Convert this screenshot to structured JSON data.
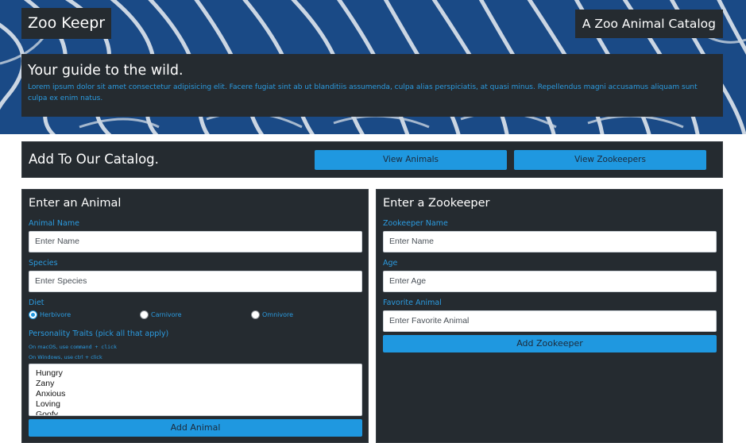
{
  "header": {
    "logo": "Zoo Keepr",
    "tagline": "A Zoo Animal Catalog"
  },
  "hero": {
    "title": "Your guide to the wild.",
    "text": "Lorem ipsum dolor sit amet consectetur adipisicing elit. Facere fugiat sint ab ut blanditiis assumenda, culpa alias perspiciatis, at quasi minus. Repellendus magni accusamus aliquam sunt culpa ex enim natus."
  },
  "catalog_bar": {
    "title": "Add To Our Catalog.",
    "view_animals": "View Animals",
    "view_zookeepers": "View Zookeepers"
  },
  "animal_form": {
    "title": "Enter an Animal",
    "name_label": "Animal Name",
    "name_placeholder": "Enter Name",
    "species_label": "Species",
    "species_placeholder": "Enter Species",
    "diet_label": "Diet",
    "diet_options": [
      "Herbivore",
      "Carnivore",
      "Omnivore"
    ],
    "diet_selected": "Herbivore",
    "traits_label": "Personality Traits (pick all that apply)",
    "hint_mac_prefix": "On macOS, use",
    "hint_mac_keys": "command + click",
    "hint_windows": "On Windows, use ctrl + click",
    "traits": [
      "Hungry",
      "Zany",
      "Anxious",
      "Loving",
      "Goofy"
    ],
    "submit": "Add Animal"
  },
  "keeper_form": {
    "title": "Enter a Zookeeper",
    "name_label": "Zookeeper Name",
    "name_placeholder": "Enter Name",
    "age_label": "Age",
    "age_placeholder": "Enter Age",
    "favorite_label": "Favorite Animal",
    "favorite_placeholder": "Enter Favorite Animal",
    "submit": "Add Zookeeper"
  },
  "colors": {
    "panel": "#252b30",
    "accent": "#1f98e0",
    "accent_text": "#2b9be0",
    "hero_blue": "#1a4a86"
  }
}
